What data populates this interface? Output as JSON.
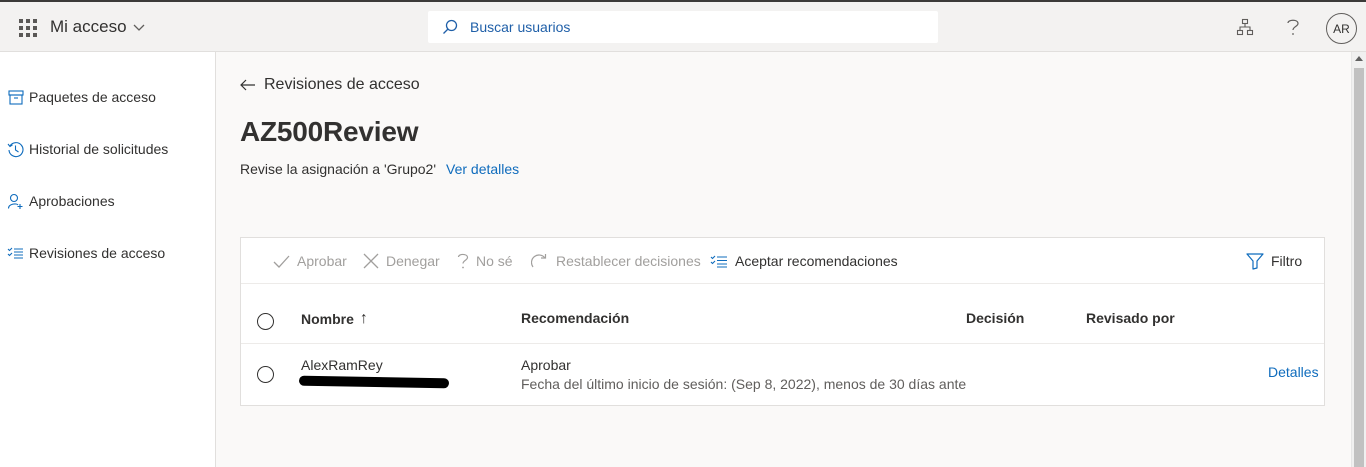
{
  "topbar": {
    "app_title": "Mi acceso",
    "search_placeholder": "Buscar usuarios",
    "avatar_initials": "AR"
  },
  "sidebar": {
    "items": [
      {
        "label": "Paquetes de acceso",
        "icon": "package-icon"
      },
      {
        "label": "Historial de solicitudes",
        "icon": "history-icon"
      },
      {
        "label": "Aprobaciones",
        "icon": "person-add-icon"
      },
      {
        "label": "Revisiones de acceso",
        "icon": "checklist-icon"
      }
    ]
  },
  "main": {
    "back_label": "Revisiones de acceso",
    "title": "AZ500Review",
    "subtitle": "Revise la asignación a 'Grupo2'",
    "details_link": "Ver detalles"
  },
  "commands": {
    "approve": "Aprobar",
    "deny": "Denegar",
    "dont_know": "No sé",
    "reset": "Restablecer decisiones",
    "accept_recommendations": "Aceptar recomendaciones",
    "filter": "Filtro"
  },
  "table": {
    "columns": {
      "name": "Nombre",
      "recommendation": "Recomendación",
      "decision": "Decisión",
      "reviewed_by": "Revisado por"
    },
    "sort_indicator": "↑",
    "rows": [
      {
        "name": "AlexRamRey",
        "recommendation": "Aprobar",
        "recommendation_detail": "Fecha del último inicio de sesión: (Sep 8, 2022), menos de 30 días ante",
        "decision": "",
        "reviewed_by": "",
        "details_label": "Detalles"
      }
    ]
  },
  "colors": {
    "accent": "#0f6cbd",
    "topbar_bg": "#f3f2f1",
    "main_bg": "#faf9f8",
    "disabled_text": "#a19f9d"
  }
}
